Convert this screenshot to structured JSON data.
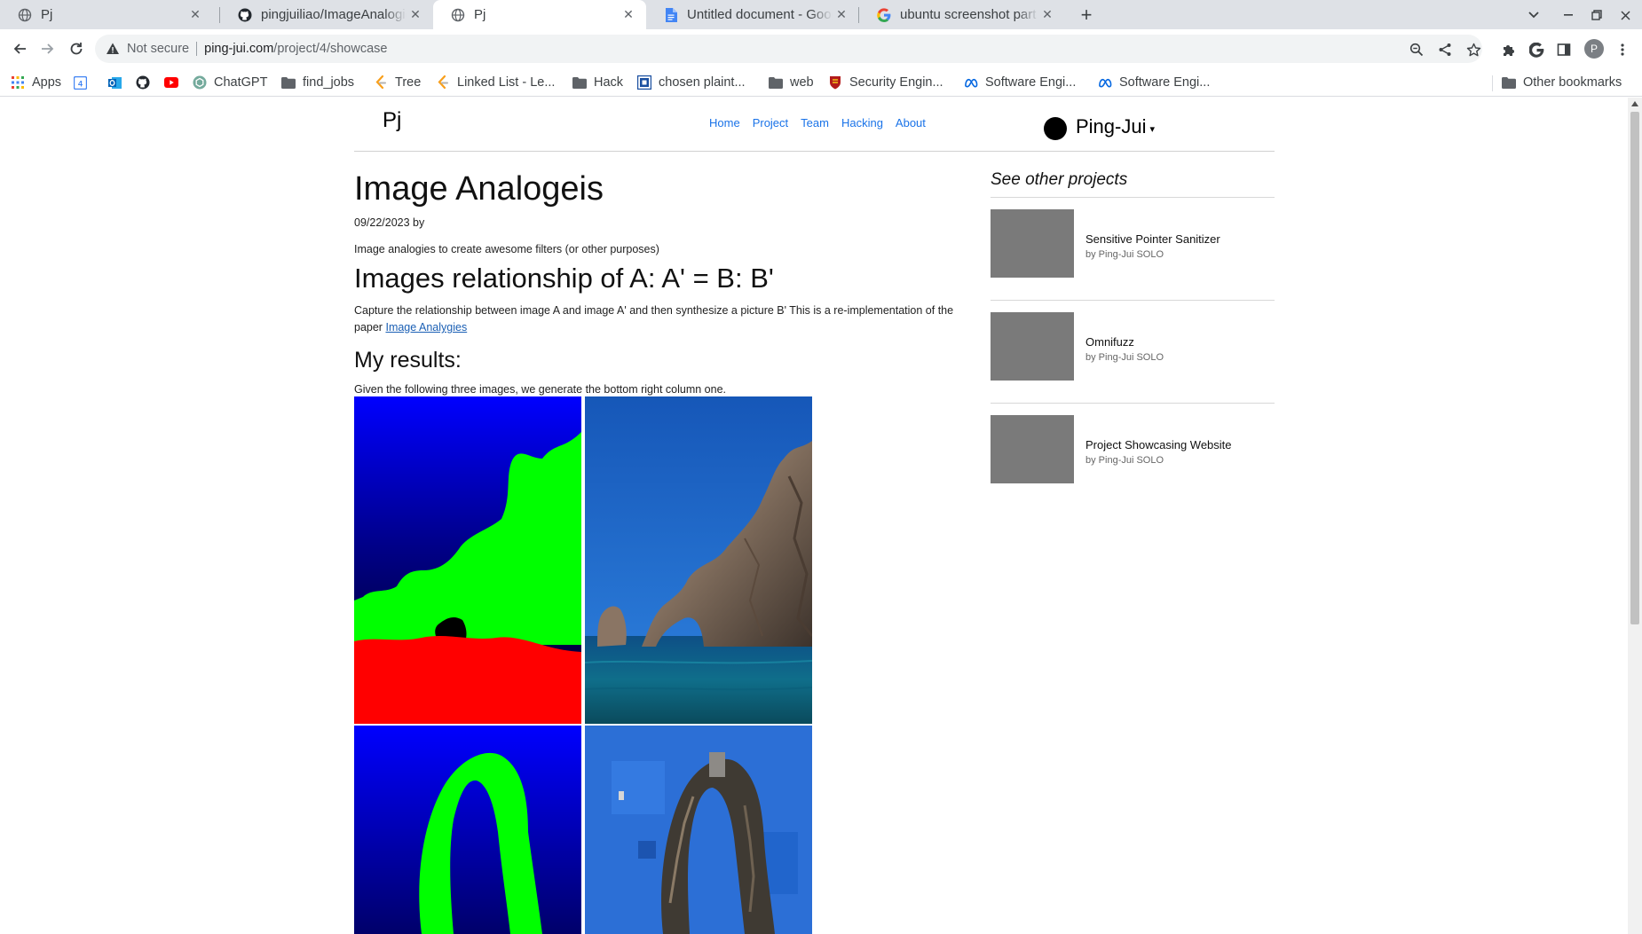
{
  "browser": {
    "tabs": [
      {
        "title": "Pj",
        "favicon": "globe-icon",
        "active": false
      },
      {
        "title": "pingjuiliao/ImageAnalogies",
        "favicon": "github-icon",
        "active": false
      },
      {
        "title": "Pj",
        "favicon": "globe-icon",
        "active": true
      },
      {
        "title": "Untitled document - Google Docs",
        "favicon": "docs-icon",
        "active": false
      },
      {
        "title": "ubuntu screenshot part of screen",
        "favicon": "google-icon",
        "active": false
      }
    ],
    "security_label": "Not secure",
    "url_host": "ping-jui.com",
    "url_path": "/project/4/showcase",
    "profile_initial": "P",
    "bookmarks": [
      {
        "label": "Apps",
        "icon": "apps-grid-icon"
      },
      {
        "label": "",
        "icon": "calendar-icon"
      },
      {
        "label": "",
        "icon": "outlook-icon"
      },
      {
        "label": "",
        "icon": "github-icon"
      },
      {
        "label": "",
        "icon": "youtube-icon"
      },
      {
        "label": "ChatGPT",
        "icon": "chatgpt-icon"
      },
      {
        "label": "find_jobs",
        "icon": "folder-icon"
      },
      {
        "label": "Tree",
        "icon": "leetcode-icon"
      },
      {
        "label": "Linked List - Le...",
        "icon": "leetcode-icon"
      },
      {
        "label": "Hack",
        "icon": "folder-icon"
      },
      {
        "label": "chosen plaint...",
        "icon": "chosen-icon"
      },
      {
        "label": "web",
        "icon": "folder-icon"
      },
      {
        "label": "Security Engin...",
        "icon": "shield-crest-icon"
      },
      {
        "label": "Software Engi...",
        "icon": "meta-icon"
      },
      {
        "label": "Software Engi...",
        "icon": "meta-icon"
      }
    ],
    "other_bookmarks": "Other bookmarks"
  },
  "site": {
    "brand": "Pj",
    "nav": [
      "Home",
      "Project",
      "Team",
      "Hacking",
      "About"
    ],
    "user_name": "Ping-Jui",
    "user_caret": "▾"
  },
  "article": {
    "title": "Image Analogeis",
    "date_line": "09/22/2023 by",
    "intro": "Image analogies to create awesome filters (or other purposes)",
    "heading": "Images relationship of A: A' = B: B'",
    "paragraph": "Capture the relationship between image A and image A' and then synthesize a picture B' This is a re-implementation of the paper",
    "paper_link": "Image Analygies",
    "results_heading": "My results:",
    "results_caption": "Given the following three images, we generate the bottom right column one."
  },
  "sidebar": {
    "title": "See other projects",
    "projects": [
      {
        "name": "Sensitive Pointer Sanitizer",
        "by": "by Ping-Jui SOLO"
      },
      {
        "name": "Omnifuzz",
        "by": "by Ping-Jui SOLO"
      },
      {
        "name": "Project Showcasing Website",
        "by": "by Ping-Jui SOLO"
      }
    ]
  }
}
